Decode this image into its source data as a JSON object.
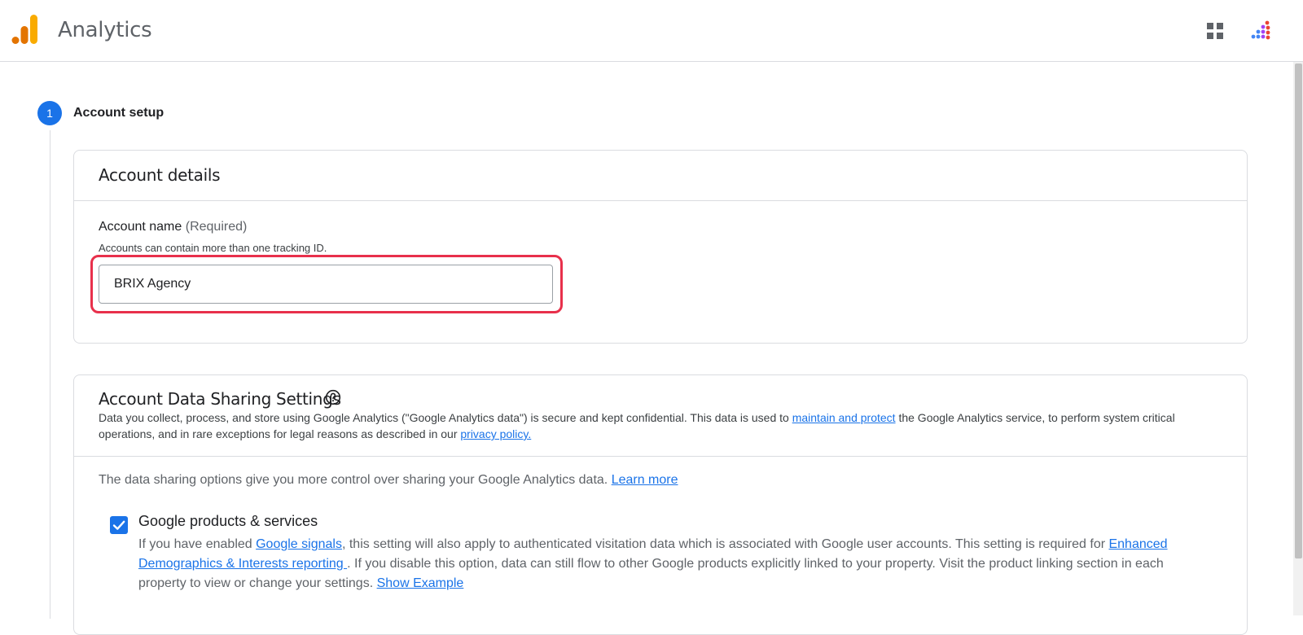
{
  "header": {
    "app_title": "Analytics",
    "logo_icon": "analytics-logo-icon",
    "apps_icon": "apps-grid-icon",
    "account_icon": "account-dots-icon"
  },
  "stepper": {
    "step_number": "1",
    "step_title": "Account setup"
  },
  "account_details": {
    "title": "Account details",
    "field_label": "Account name",
    "field_required": "(Required)",
    "field_hint": "Accounts can contain more than one tracking ID.",
    "field_value": "BRIX Agency"
  },
  "data_sharing": {
    "title": "Account Data Sharing Settings",
    "desc_part1": "Data you collect, process, and store using Google Analytics (\"Google Analytics data\") is secure and kept confidential. This data is used to ",
    "desc_link1": "maintain and protect",
    "desc_part2": " the Google Analytics service, to perform system critical operations, and in rare exceptions for legal reasons as described in our ",
    "desc_link2": "privacy policy.",
    "intro_text": "The data sharing options give you more control over sharing your Google Analytics data. ",
    "intro_link": "Learn more",
    "options": [
      {
        "title": "Google products & services",
        "checked": true,
        "desc_part1": "If you have enabled ",
        "desc_link1": "Google signals",
        "desc_part2": ", this setting will also apply to authenticated visitation data which is associated with Google user accounts. This setting is required for ",
        "desc_link2": "Enhanced Demographics & Interests reporting ",
        "desc_part3": ". If you disable this option, data can still flow to other Google products explicitly linked to your property. Visit the product linking section in each property to view or change your settings. ",
        "desc_link3": "Show Example"
      }
    ]
  },
  "colors": {
    "accent": "#1a73e8",
    "highlight": "#e8304b",
    "logo_orange": "#f9ab00",
    "logo_dark_orange": "#e37400"
  }
}
